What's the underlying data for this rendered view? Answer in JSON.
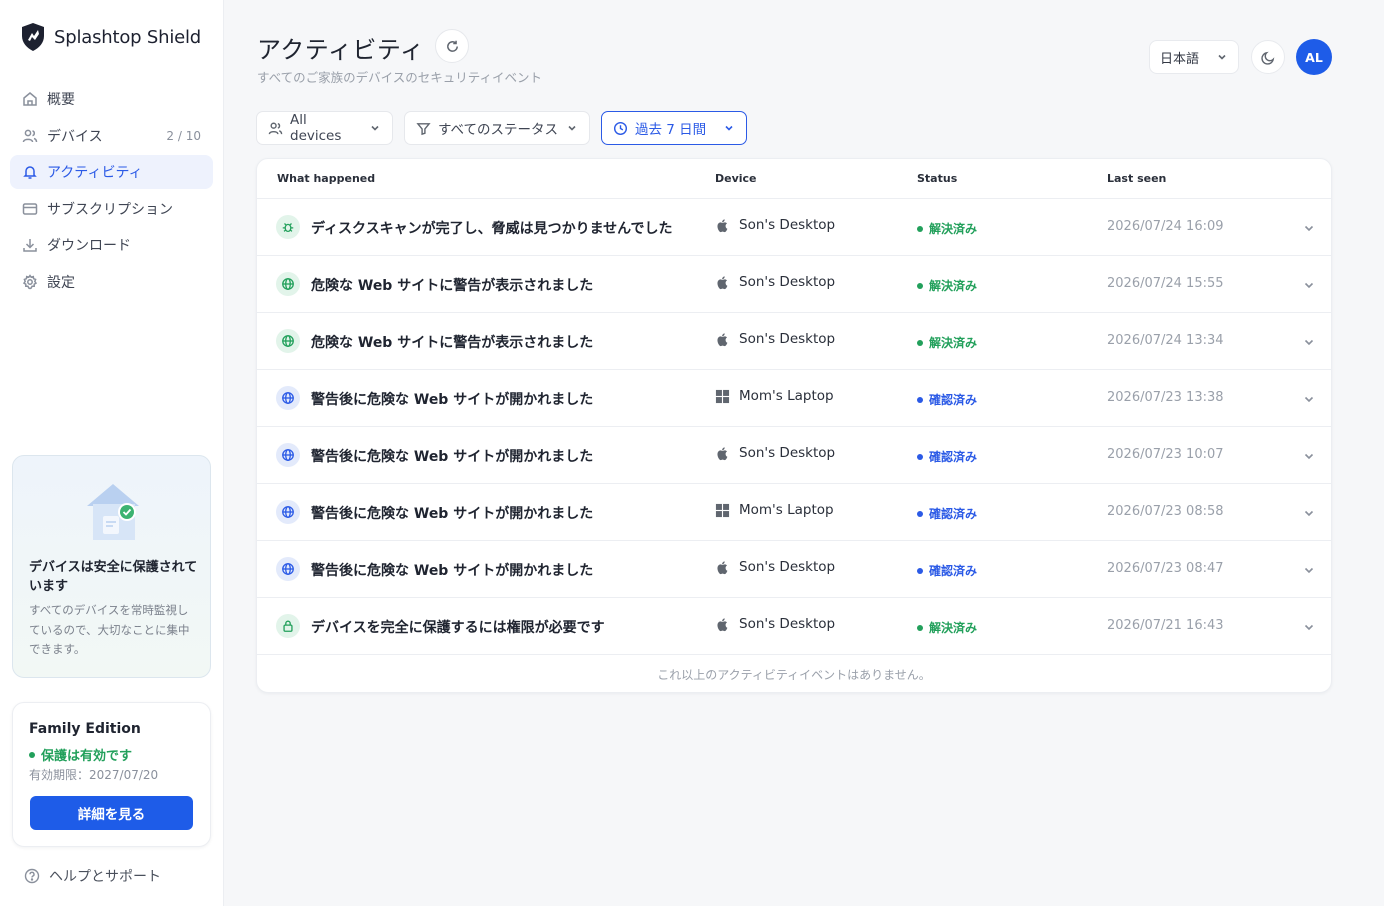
{
  "brand": {
    "name": "Splashtop Shield"
  },
  "sidebar": {
    "items": [
      {
        "label": "概要",
        "icon": "home-icon",
        "count": ""
      },
      {
        "label": "デバイス",
        "icon": "users-icon",
        "count": "2 / 10"
      },
      {
        "label": "アクティビティ",
        "icon": "bell-icon",
        "count": "",
        "active": true
      },
      {
        "label": "サブスクリプション",
        "icon": "card-icon",
        "count": ""
      },
      {
        "label": "ダウンロード",
        "icon": "download-icon",
        "count": ""
      },
      {
        "label": "設定",
        "icon": "gear-icon",
        "count": ""
      }
    ],
    "promo": {
      "title": "デバイスは安全に保護されています",
      "text": "すべてのデバイスを常時監視しているので、大切なことに集中できます。"
    },
    "plan": {
      "title": "Family Edition",
      "status": "保護は有効です",
      "expiry": "有効期限：2027/07/20",
      "button": "詳細を見る"
    },
    "help": "ヘルプとサポート"
  },
  "header": {
    "title": "アクティビティ",
    "subtitle": "すべてのご家族のデバイスのセキュリティイベント",
    "language": "日本語",
    "avatar": "AL"
  },
  "filters": {
    "devices": "All devices",
    "status": "すべてのステータス",
    "period": "過去 7 日間"
  },
  "table": {
    "columns": {
      "what": "What happened",
      "device": "Device",
      "status": "Status",
      "last_seen": "Last seen"
    },
    "rows": [
      {
        "icon": "bug-icon",
        "tone": "green",
        "event": "ディスクスキャンが完了し、脅威は見つかりませんでした",
        "os": "apple",
        "device": "Son's Desktop",
        "status": "解決済み",
        "status_kind": "ok",
        "time": "2026/07/24 16:09"
      },
      {
        "icon": "globe-icon",
        "tone": "green",
        "event": "危険な Web サイトに警告が表示されました",
        "os": "apple",
        "device": "Son's Desktop",
        "status": "解決済み",
        "status_kind": "ok",
        "time": "2026/07/24 15:55"
      },
      {
        "icon": "globe-icon",
        "tone": "green",
        "event": "危険な Web サイトに警告が表示されました",
        "os": "apple",
        "device": "Son's Desktop",
        "status": "解決済み",
        "status_kind": "ok",
        "time": "2026/07/24 13:34"
      },
      {
        "icon": "globe-icon",
        "tone": "blue",
        "event": "警告後に危険な Web サイトが開かれました",
        "os": "windows",
        "device": "Mom's Laptop",
        "status": "確認済み",
        "status_kind": "ack",
        "time": "2026/07/23 13:38"
      },
      {
        "icon": "globe-icon",
        "tone": "blue",
        "event": "警告後に危険な Web サイトが開かれました",
        "os": "apple",
        "device": "Son's Desktop",
        "status": "確認済み",
        "status_kind": "ack",
        "time": "2026/07/23 10:07"
      },
      {
        "icon": "globe-icon",
        "tone": "blue",
        "event": "警告後に危険な Web サイトが開かれました",
        "os": "windows",
        "device": "Mom's Laptop",
        "status": "確認済み",
        "status_kind": "ack",
        "time": "2026/07/23 08:58"
      },
      {
        "icon": "globe-icon",
        "tone": "blue",
        "event": "警告後に危険な Web サイトが開かれました",
        "os": "apple",
        "device": "Son's Desktop",
        "status": "確認済み",
        "status_kind": "ack",
        "time": "2026/07/23 08:47"
      },
      {
        "icon": "lock-icon",
        "tone": "green",
        "event": "デバイスを完全に保護するには権限が必要です",
        "os": "apple",
        "device": "Son's Desktop",
        "status": "解決済み",
        "status_kind": "ok",
        "time": "2026/07/21 16:43"
      }
    ],
    "footnote": "これ以上のアクティビティイベントはありません。"
  },
  "colors": {
    "accent": "#1e5ce8",
    "success": "#22a05b",
    "background": "#f6f7f9"
  }
}
